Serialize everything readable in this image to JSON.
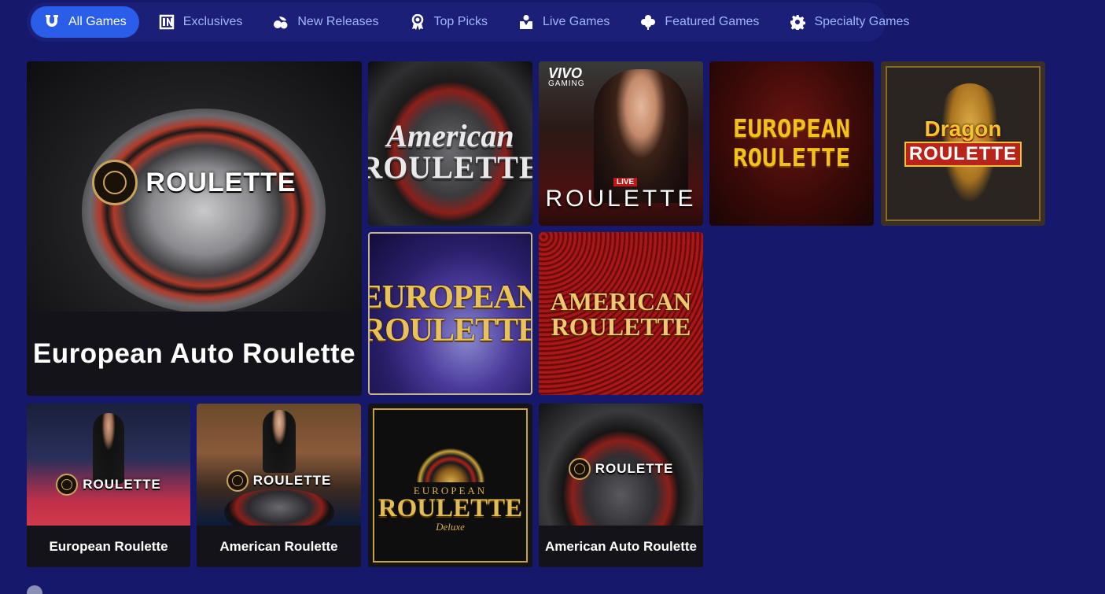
{
  "tabs": [
    {
      "label": "All Games",
      "icon": "horseshoe-icon",
      "active": true
    },
    {
      "label": "Exclusives",
      "icon": "exclusive-badge-icon",
      "active": false
    },
    {
      "label": "New Releases",
      "icon": "cherries-icon",
      "active": false
    },
    {
      "label": "Top Picks",
      "icon": "award-ribbon-icon",
      "active": false
    },
    {
      "label": "Live Games",
      "icon": "dealer-icon",
      "active": false
    },
    {
      "label": "Featured Games",
      "icon": "clover-icon",
      "active": false
    },
    {
      "label": "Specialty Games",
      "icon": "gear-icon",
      "active": false
    }
  ],
  "featured": {
    "logo_text": "ROULETTE",
    "title": "European Auto Roulette"
  },
  "tiles": {
    "american_roulette_chrome": {
      "line1": "American",
      "line2": "ROULETTE"
    },
    "vivo_live_roulette": {
      "brand_line1": "VIVO",
      "brand_line2": "GAMING",
      "tag": "LIVE",
      "title": "ROULETTE"
    },
    "european_roulette_red": {
      "line1": "EUROPEAN",
      "line2": "ROULETTE"
    },
    "dragon_roulette": {
      "line1": "Dragon",
      "line2": "ROULETTE"
    },
    "european_roulette_purple": {
      "line1": "EUROPEAN",
      "line2": "ROULETTE"
    },
    "american_roulette_red": {
      "line1": "AMERICAN",
      "line2": "ROULETTE"
    },
    "european_roulette_live": {
      "logo_text": "ROULETTE",
      "caption": "European Roulette"
    },
    "american_roulette_live": {
      "logo_text": "ROULETTE",
      "caption": "American Roulette"
    },
    "european_roulette_deluxe": {
      "line1": "EUROPEAN",
      "line2": "ROULETTE",
      "line3": "Deluxe"
    },
    "american_auto_roulette": {
      "logo_text": "ROULETTE",
      "caption": "American Auto Roulette"
    }
  },
  "colors": {
    "background": "#15186b",
    "tab_bar": "#1b1f77",
    "tab_active": "#2a5ee8",
    "tab_text": "#9fb6ff",
    "gold": "#d9a53a"
  }
}
